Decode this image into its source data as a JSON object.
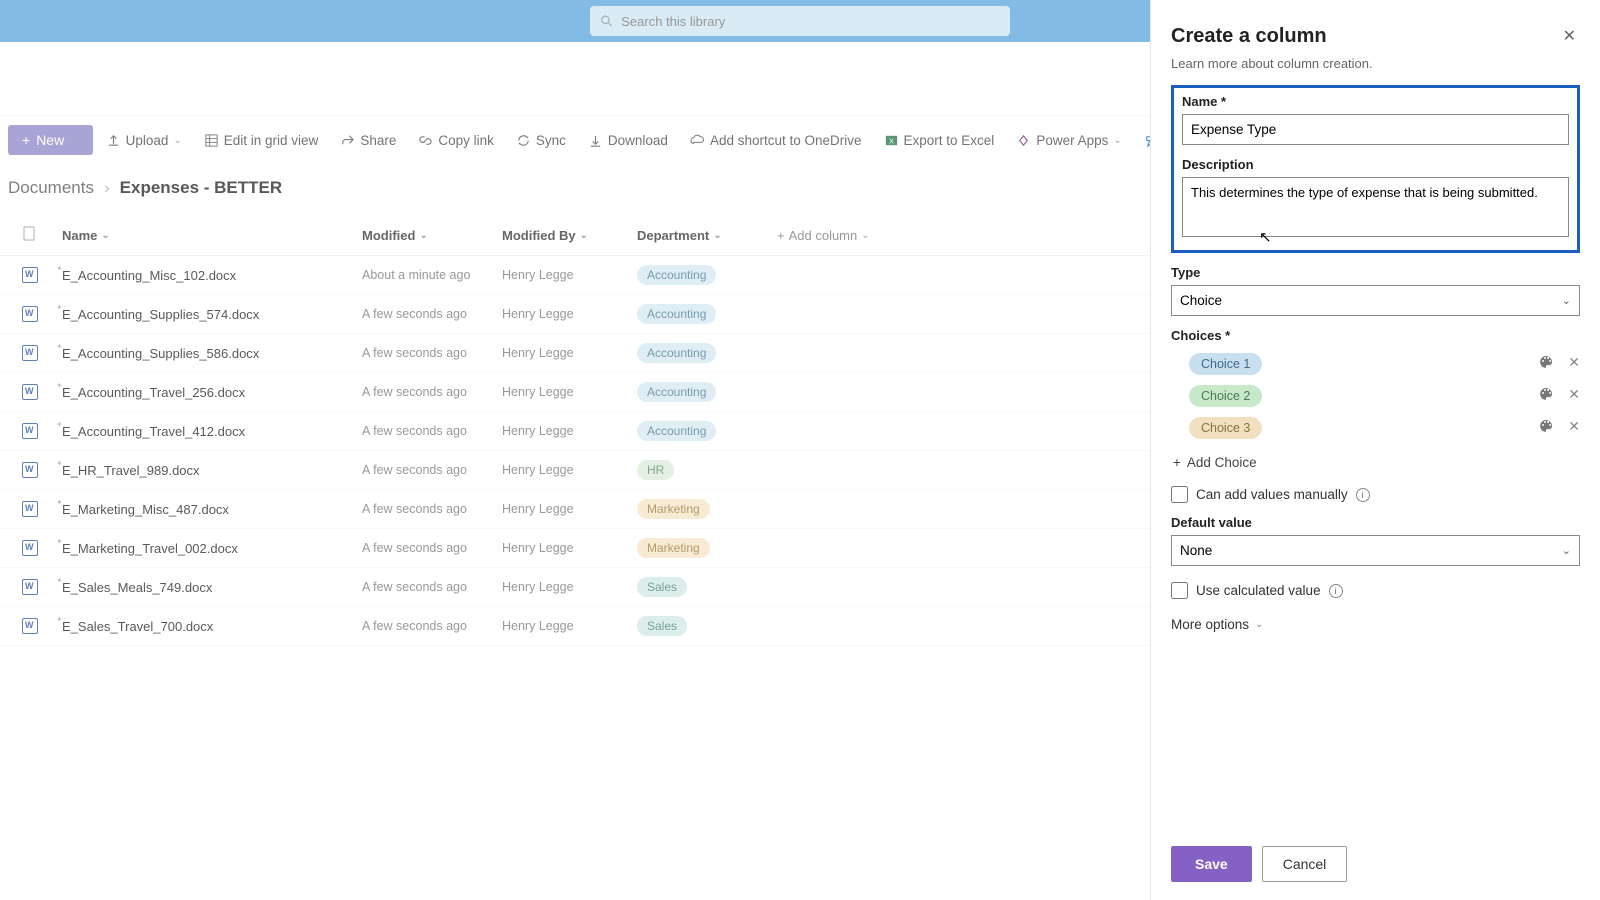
{
  "search": {
    "placeholder": "Search this library"
  },
  "toolbar": {
    "new": "New",
    "upload": "Upload",
    "editGrid": "Edit in grid view",
    "share": "Share",
    "copyLink": "Copy link",
    "sync": "Sync",
    "download": "Download",
    "shortcut": "Add shortcut to OneDrive",
    "excel": "Export to Excel",
    "powerApps": "Power Apps",
    "automate": "Automate"
  },
  "breadcrumb": {
    "root": "Documents",
    "current": "Expenses - BETTER"
  },
  "columns": {
    "name": "Name",
    "modified": "Modified",
    "modifiedBy": "Modified By",
    "department": "Department",
    "add": "Add column"
  },
  "rows": [
    {
      "name": "E_Accounting_Misc_102.docx",
      "modified": "About a minute ago",
      "by": "Henry Legge",
      "dept": "Accounting",
      "deptClass": "pill-accounting"
    },
    {
      "name": "E_Accounting_Supplies_574.docx",
      "modified": "A few seconds ago",
      "by": "Henry Legge",
      "dept": "Accounting",
      "deptClass": "pill-accounting"
    },
    {
      "name": "E_Accounting_Supplies_586.docx",
      "modified": "A few seconds ago",
      "by": "Henry Legge",
      "dept": "Accounting",
      "deptClass": "pill-accounting"
    },
    {
      "name": "E_Accounting_Travel_256.docx",
      "modified": "A few seconds ago",
      "by": "Henry Legge",
      "dept": "Accounting",
      "deptClass": "pill-accounting"
    },
    {
      "name": "E_Accounting_Travel_412.docx",
      "modified": "A few seconds ago",
      "by": "Henry Legge",
      "dept": "Accounting",
      "deptClass": "pill-accounting"
    },
    {
      "name": "E_HR_Travel_989.docx",
      "modified": "A few seconds ago",
      "by": "Henry Legge",
      "dept": "HR",
      "deptClass": "pill-hr"
    },
    {
      "name": "E_Marketing_Misc_487.docx",
      "modified": "A few seconds ago",
      "by": "Henry Legge",
      "dept": "Marketing",
      "deptClass": "pill-marketing"
    },
    {
      "name": "E_Marketing_Travel_002.docx",
      "modified": "A few seconds ago",
      "by": "Henry Legge",
      "dept": "Marketing",
      "deptClass": "pill-marketing"
    },
    {
      "name": "E_Sales_Meals_749.docx",
      "modified": "A few seconds ago",
      "by": "Henry Legge",
      "dept": "Sales",
      "deptClass": "pill-sales"
    },
    {
      "name": "E_Sales_Travel_700.docx",
      "modified": "A few seconds ago",
      "by": "Henry Legge",
      "dept": "Sales",
      "deptClass": "pill-sales"
    }
  ],
  "panel": {
    "title": "Create a column",
    "subtitle": "Learn more about column creation.",
    "nameLabel": "Name *",
    "nameValue": "Expense Type",
    "descLabel": "Description",
    "descValue": "This determines the type of expense that is being submitted.",
    "typeLabel": "Type",
    "typeValue": "Choice",
    "choicesLabel": "Choices *",
    "choices": [
      {
        "label": "Choice 1",
        "cls": "cp1"
      },
      {
        "label": "Choice 2",
        "cls": "cp2"
      },
      {
        "label": "Choice 3",
        "cls": "cp3"
      }
    ],
    "addChoice": "Add Choice",
    "canAddManually": "Can add values manually",
    "defaultLabel": "Default value",
    "defaultValue": "None",
    "useCalculated": "Use calculated value",
    "moreOptions": "More options",
    "save": "Save",
    "cancel": "Cancel"
  }
}
